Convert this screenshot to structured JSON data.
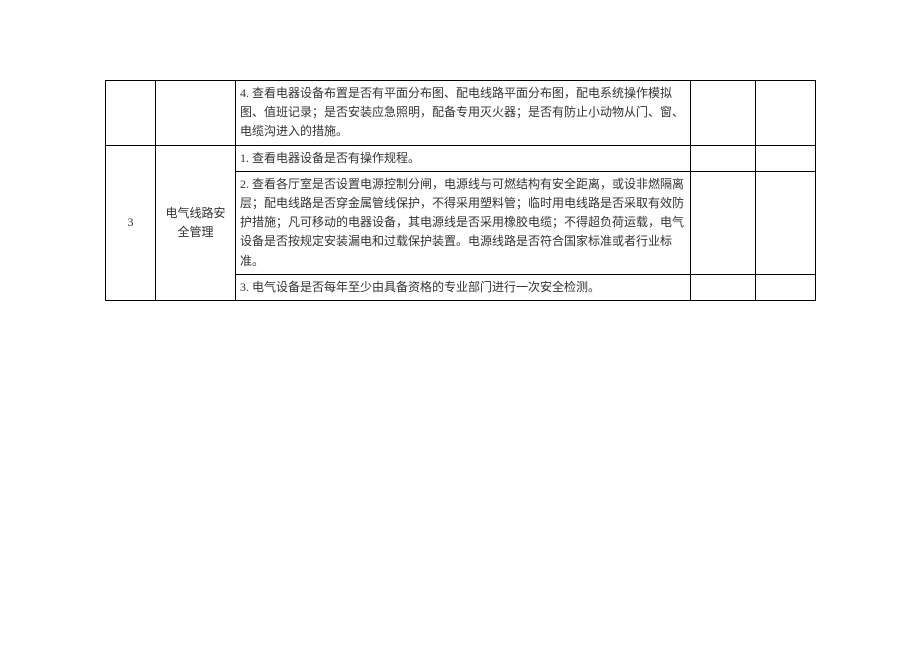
{
  "rows": [
    {
      "num": "",
      "category": "",
      "desc": "4. 查看电器设备布置是否有平面分布图、配电线路平面分布图，配电系统操作模拟图、值班记录；是否安装应急照明，配备专用灭火器；是否有防止小动物从门、窗、电缆沟进入的措施。"
    },
    {
      "num": "3",
      "category": "电气线路安全管理",
      "desc1": "1. 查看电器设备是否有操作规程。",
      "desc2": "2. 查看各厅室是否设置电源控制分闸，电源线与可燃结构有安全距离，或设非燃隔离层；配电线路是否穿金属管线保护，不得采用塑料管；临时用电线路是否采取有效防护措施；凡可移动的电器设备，其电源线是否采用橡胶电缆；不得超负荷运载，电气设备是否按规定安装漏电和过载保护装置。电源线路是否符合国家标准或者行业标准。",
      "desc3": "3. 电气设备是否每年至少由具备资格的专业部门进行一次安全检测。"
    }
  ]
}
